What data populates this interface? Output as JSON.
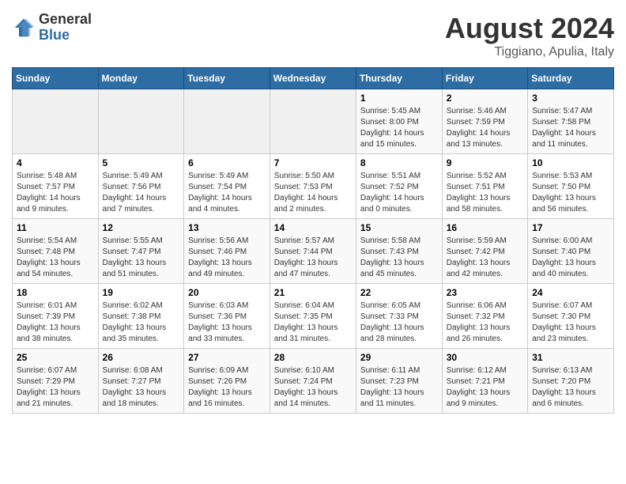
{
  "logo": {
    "general": "General",
    "blue": "Blue"
  },
  "title": "August 2024",
  "location": "Tiggiano, Apulia, Italy",
  "days_of_week": [
    "Sunday",
    "Monday",
    "Tuesday",
    "Wednesday",
    "Thursday",
    "Friday",
    "Saturday"
  ],
  "weeks": [
    [
      {
        "day": "",
        "info": ""
      },
      {
        "day": "",
        "info": ""
      },
      {
        "day": "",
        "info": ""
      },
      {
        "day": "",
        "info": ""
      },
      {
        "day": "1",
        "info": "Sunrise: 5:45 AM\nSunset: 8:00 PM\nDaylight: 14 hours and 15 minutes."
      },
      {
        "day": "2",
        "info": "Sunrise: 5:46 AM\nSunset: 7:59 PM\nDaylight: 14 hours and 13 minutes."
      },
      {
        "day": "3",
        "info": "Sunrise: 5:47 AM\nSunset: 7:58 PM\nDaylight: 14 hours and 11 minutes."
      }
    ],
    [
      {
        "day": "4",
        "info": "Sunrise: 5:48 AM\nSunset: 7:57 PM\nDaylight: 14 hours and 9 minutes."
      },
      {
        "day": "5",
        "info": "Sunrise: 5:49 AM\nSunset: 7:56 PM\nDaylight: 14 hours and 7 minutes."
      },
      {
        "day": "6",
        "info": "Sunrise: 5:49 AM\nSunset: 7:54 PM\nDaylight: 14 hours and 4 minutes."
      },
      {
        "day": "7",
        "info": "Sunrise: 5:50 AM\nSunset: 7:53 PM\nDaylight: 14 hours and 2 minutes."
      },
      {
        "day": "8",
        "info": "Sunrise: 5:51 AM\nSunset: 7:52 PM\nDaylight: 14 hours and 0 minutes."
      },
      {
        "day": "9",
        "info": "Sunrise: 5:52 AM\nSunset: 7:51 PM\nDaylight: 13 hours and 58 minutes."
      },
      {
        "day": "10",
        "info": "Sunrise: 5:53 AM\nSunset: 7:50 PM\nDaylight: 13 hours and 56 minutes."
      }
    ],
    [
      {
        "day": "11",
        "info": "Sunrise: 5:54 AM\nSunset: 7:48 PM\nDaylight: 13 hours and 54 minutes."
      },
      {
        "day": "12",
        "info": "Sunrise: 5:55 AM\nSunset: 7:47 PM\nDaylight: 13 hours and 51 minutes."
      },
      {
        "day": "13",
        "info": "Sunrise: 5:56 AM\nSunset: 7:46 PM\nDaylight: 13 hours and 49 minutes."
      },
      {
        "day": "14",
        "info": "Sunrise: 5:57 AM\nSunset: 7:44 PM\nDaylight: 13 hours and 47 minutes."
      },
      {
        "day": "15",
        "info": "Sunrise: 5:58 AM\nSunset: 7:43 PM\nDaylight: 13 hours and 45 minutes."
      },
      {
        "day": "16",
        "info": "Sunrise: 5:59 AM\nSunset: 7:42 PM\nDaylight: 13 hours and 42 minutes."
      },
      {
        "day": "17",
        "info": "Sunrise: 6:00 AM\nSunset: 7:40 PM\nDaylight: 13 hours and 40 minutes."
      }
    ],
    [
      {
        "day": "18",
        "info": "Sunrise: 6:01 AM\nSunset: 7:39 PM\nDaylight: 13 hours and 38 minutes."
      },
      {
        "day": "19",
        "info": "Sunrise: 6:02 AM\nSunset: 7:38 PM\nDaylight: 13 hours and 35 minutes."
      },
      {
        "day": "20",
        "info": "Sunrise: 6:03 AM\nSunset: 7:36 PM\nDaylight: 13 hours and 33 minutes."
      },
      {
        "day": "21",
        "info": "Sunrise: 6:04 AM\nSunset: 7:35 PM\nDaylight: 13 hours and 31 minutes."
      },
      {
        "day": "22",
        "info": "Sunrise: 6:05 AM\nSunset: 7:33 PM\nDaylight: 13 hours and 28 minutes."
      },
      {
        "day": "23",
        "info": "Sunrise: 6:06 AM\nSunset: 7:32 PM\nDaylight: 13 hours and 26 minutes."
      },
      {
        "day": "24",
        "info": "Sunrise: 6:07 AM\nSunset: 7:30 PM\nDaylight: 13 hours and 23 minutes."
      }
    ],
    [
      {
        "day": "25",
        "info": "Sunrise: 6:07 AM\nSunset: 7:29 PM\nDaylight: 13 hours and 21 minutes."
      },
      {
        "day": "26",
        "info": "Sunrise: 6:08 AM\nSunset: 7:27 PM\nDaylight: 13 hours and 18 minutes."
      },
      {
        "day": "27",
        "info": "Sunrise: 6:09 AM\nSunset: 7:26 PM\nDaylight: 13 hours and 16 minutes."
      },
      {
        "day": "28",
        "info": "Sunrise: 6:10 AM\nSunset: 7:24 PM\nDaylight: 13 hours and 14 minutes."
      },
      {
        "day": "29",
        "info": "Sunrise: 6:11 AM\nSunset: 7:23 PM\nDaylight: 13 hours and 11 minutes."
      },
      {
        "day": "30",
        "info": "Sunrise: 6:12 AM\nSunset: 7:21 PM\nDaylight: 13 hours and 9 minutes."
      },
      {
        "day": "31",
        "info": "Sunrise: 6:13 AM\nSunset: 7:20 PM\nDaylight: 13 hours and 6 minutes."
      }
    ]
  ]
}
